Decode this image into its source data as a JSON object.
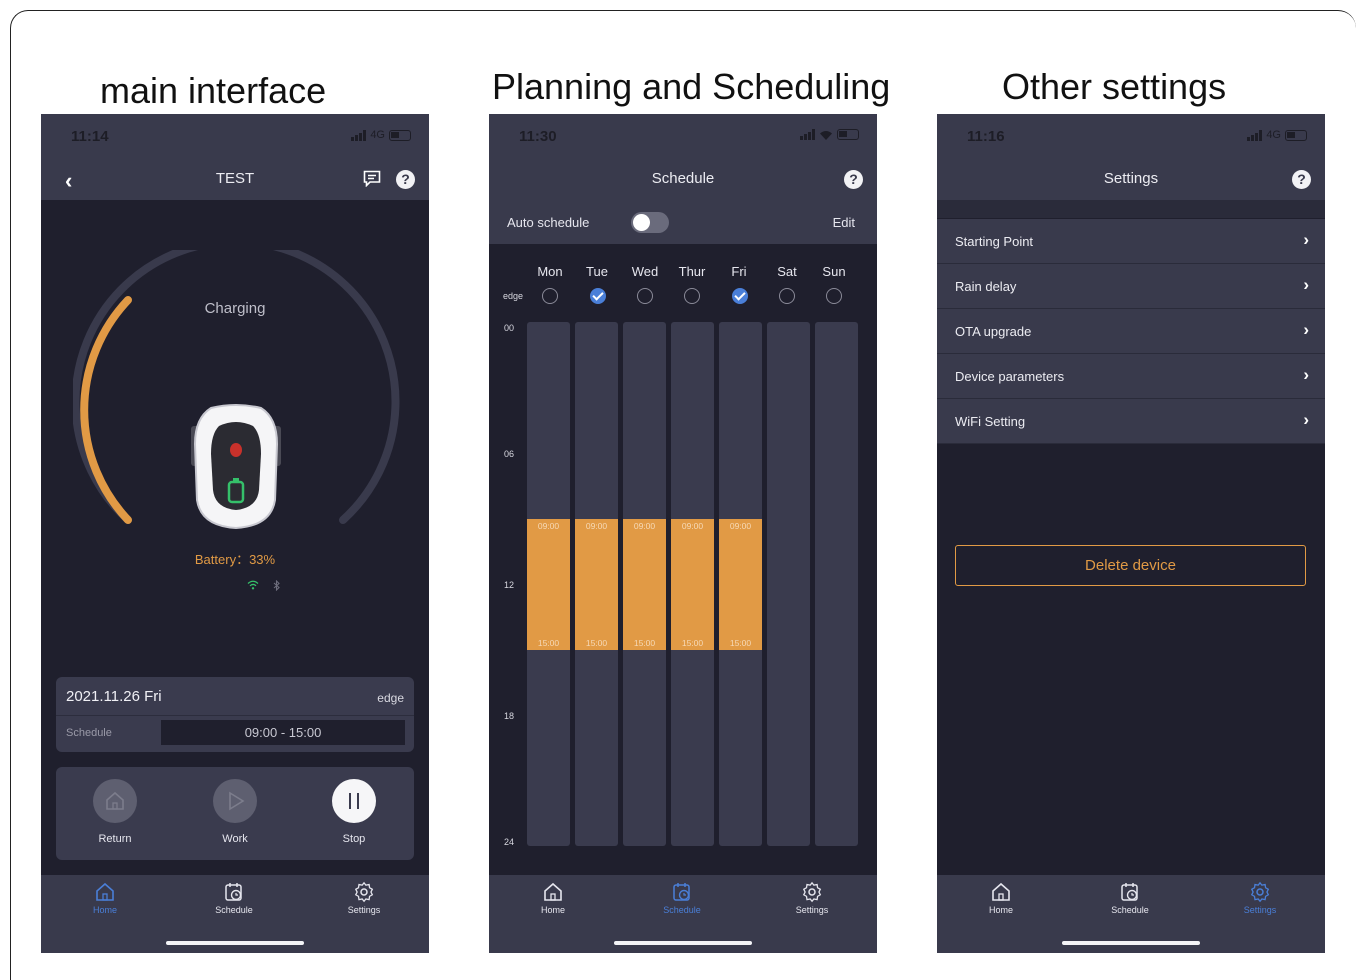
{
  "titles": {
    "main": "main interface",
    "schedule": "Planning and Scheduling",
    "settings": "Other settings"
  },
  "colors": {
    "accent_orange": "#e19a45",
    "accent_blue": "#4a7fd8",
    "bg_dark": "#1f1f2d",
    "bar_bg": "#393a4c"
  },
  "tabs": {
    "home": "Home",
    "schedule": "Schedule",
    "settings": "Settings"
  },
  "main": {
    "status_time": "11:14",
    "network": "4G",
    "title": "TEST",
    "charging_label": "Charging",
    "battery_label": "Battery：33%",
    "battery_percent": 33,
    "date": "2021.11.26 Fri",
    "mode": "edge",
    "schedule_label": "Schedule",
    "schedule_value": "09:00 - 15:00",
    "controls": {
      "return": "Return",
      "work": "Work",
      "stop": "Stop"
    },
    "active_tab": "home"
  },
  "schedule": {
    "status_time": "11:30",
    "title": "Schedule",
    "auto_schedule_label": "Auto schedule",
    "auto_schedule_on": false,
    "edit_label": "Edit",
    "edge_label": "edge",
    "days": [
      "Mon",
      "Tue",
      "Wed",
      "Thur",
      "Fri",
      "Sat",
      "Sun"
    ],
    "edge_checked": [
      false,
      true,
      false,
      false,
      true,
      false,
      false
    ],
    "hours": [
      "00",
      "06",
      "12",
      "18",
      "24"
    ],
    "slots": [
      {
        "day": "Mon",
        "start": "09:00",
        "end": "15:00"
      },
      {
        "day": "Tue",
        "start": "09:00",
        "end": "15:00"
      },
      {
        "day": "Wed",
        "start": "09:00",
        "end": "15:00"
      },
      {
        "day": "Thur",
        "start": "09:00",
        "end": "15:00"
      },
      {
        "day": "Fri",
        "start": "09:00",
        "end": "15:00"
      }
    ],
    "active_tab": "schedule"
  },
  "settings": {
    "status_time": "11:16",
    "network": "4G",
    "title": "Settings",
    "items": [
      "Starting Point",
      "Rain delay",
      "OTA upgrade",
      "Device parameters",
      "WiFi Setting"
    ],
    "delete_label": "Delete device",
    "active_tab": "settings"
  }
}
